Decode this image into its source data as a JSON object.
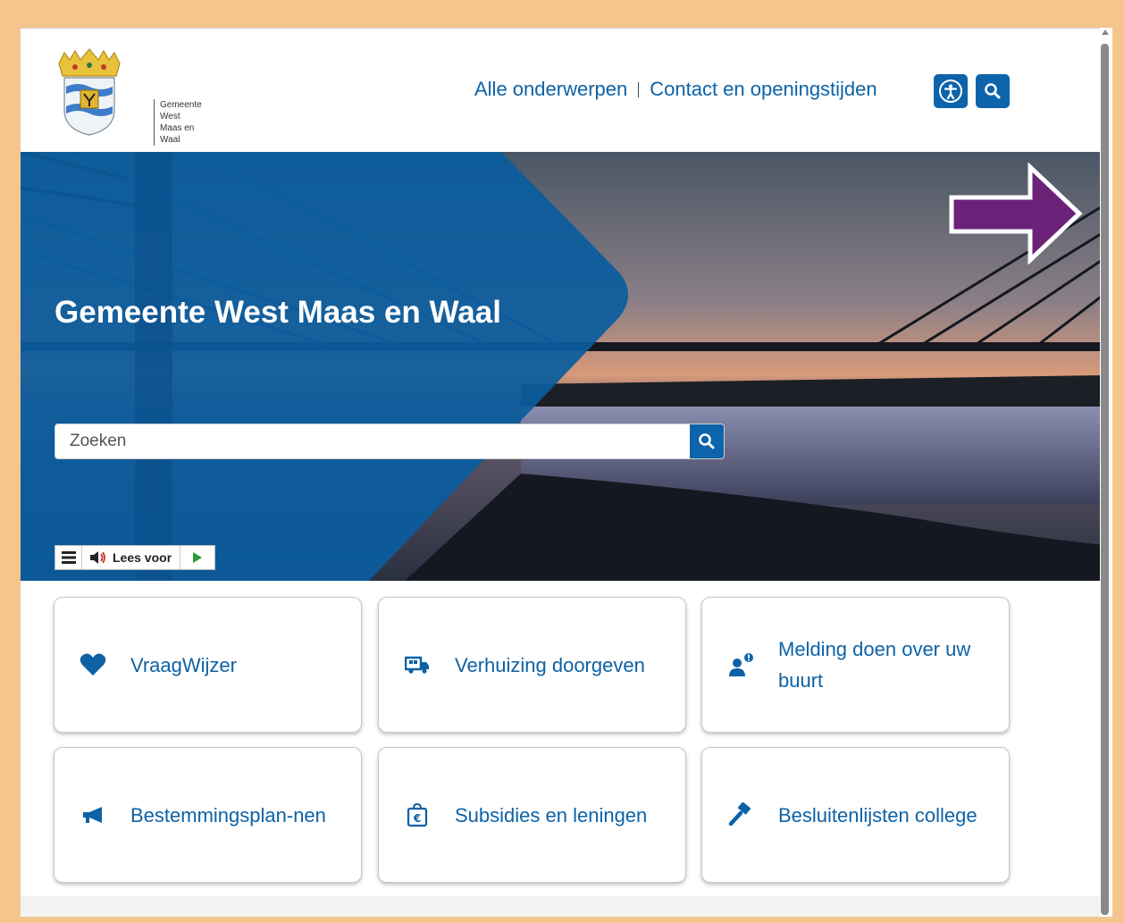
{
  "header": {
    "logo_text": [
      "Gemeente",
      "West",
      "Maas en",
      "Waal"
    ],
    "nav": [
      {
        "label": "Alle onderwerpen"
      },
      {
        "label": "Contact en openingstijden"
      }
    ],
    "accessibility_icon": "accessibility-icon",
    "search_icon": "search-icon"
  },
  "hero": {
    "title": "Gemeente West Maas en Waal",
    "search_placeholder": "Zoeken",
    "readspeaker": {
      "listen_label": "Lees voor"
    }
  },
  "tiles": [
    {
      "label": "VraagWijzer",
      "icon": "heart-icon"
    },
    {
      "label": "Verhuizing doorgeven",
      "icon": "moving-truck-icon"
    },
    {
      "label": "Melding doen over uw buurt",
      "icon": "report-person-icon"
    },
    {
      "label": "Bestemmingsplan-nen",
      "icon": "megaphone-icon"
    },
    {
      "label": "Subsidies en leningen",
      "icon": "euro-bag-icon"
    },
    {
      "label": "Besluitenlijsten college",
      "icon": "gavel-icon"
    }
  ],
  "colors": {
    "brand_blue": "#0e64aa",
    "link_blue": "#0d62a6",
    "arrow_purple": "#6b2278",
    "page_border": "#f5c58e"
  }
}
